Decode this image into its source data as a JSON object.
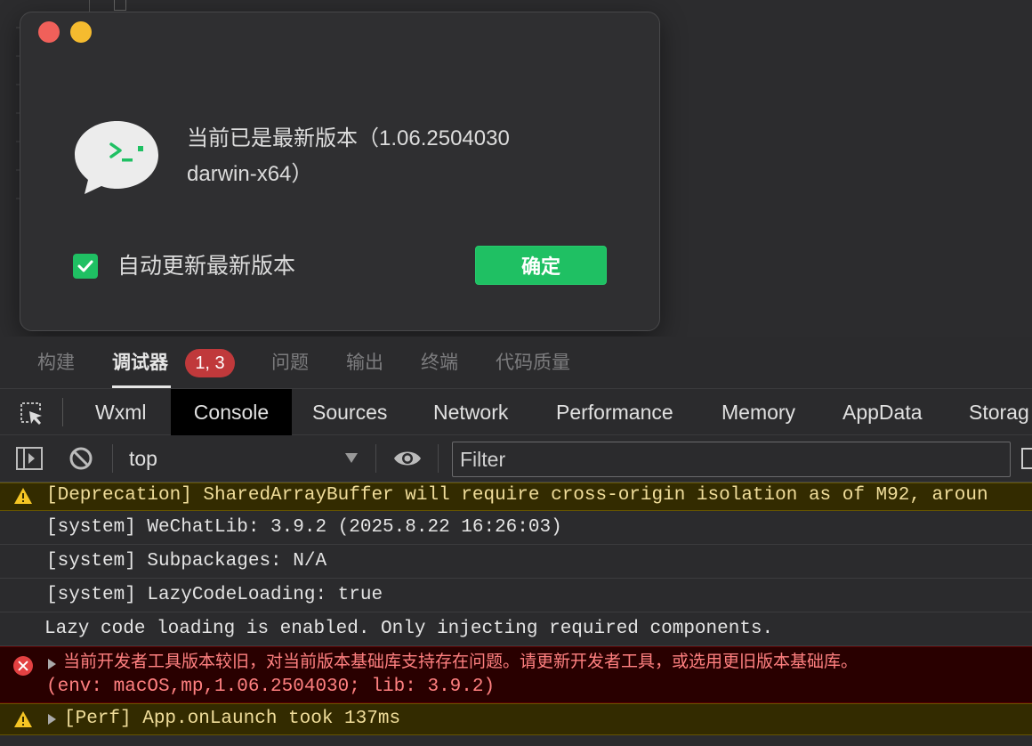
{
  "dialog": {
    "message_line1": "当前已是最新版本（1.06.2504030",
    "message_line2": "darwin-x64）",
    "auto_update_label": "自动更新最新版本",
    "auto_update_checked": true,
    "ok_label": "确定"
  },
  "panel_tabs": [
    {
      "label": "构建"
    },
    {
      "label": "调试器",
      "badge": "1, 3",
      "active": true
    },
    {
      "label": "问题"
    },
    {
      "label": "输出"
    },
    {
      "label": "终端"
    },
    {
      "label": "代码质量"
    }
  ],
  "devtools_tabs": [
    {
      "label": "Wxml"
    },
    {
      "label": "Console",
      "active": true
    },
    {
      "label": "Sources"
    },
    {
      "label": "Network"
    },
    {
      "label": "Performance"
    },
    {
      "label": "Memory"
    },
    {
      "label": "AppData"
    },
    {
      "label": "Storag"
    }
  ],
  "toolbar": {
    "context": "top",
    "filter_placeholder": "Filter"
  },
  "console_rows": [
    {
      "level": "warning",
      "text": "[Deprecation] SharedArrayBuffer will require cross-origin isolation as of M92, aroun"
    },
    {
      "level": "info",
      "text": "[system] WeChatLib: 3.9.2 (2025.8.22 16:26:03)"
    },
    {
      "level": "info",
      "text": "[system] Subpackages: N/A"
    },
    {
      "level": "info",
      "text": "[system] LazyCodeLoading: true"
    },
    {
      "level": "info",
      "text": "Lazy code loading is enabled. Only injecting required components."
    },
    {
      "level": "error",
      "line1": "当前开发者工具版本较旧，对当前版本基础库支持存在问题。请更新开发者工具，或选用更旧版本基础库。",
      "line2": "(env: macOS,mp,1.06.2504030; lib: 3.9.2)"
    },
    {
      "level": "warning",
      "text": "[Perf] App.onLaunch took 137ms"
    }
  ],
  "colors": {
    "accent_green": "#1fc063",
    "badge_red": "#c0393b",
    "warning_bg": "#332b00",
    "error_bg": "#290000"
  }
}
